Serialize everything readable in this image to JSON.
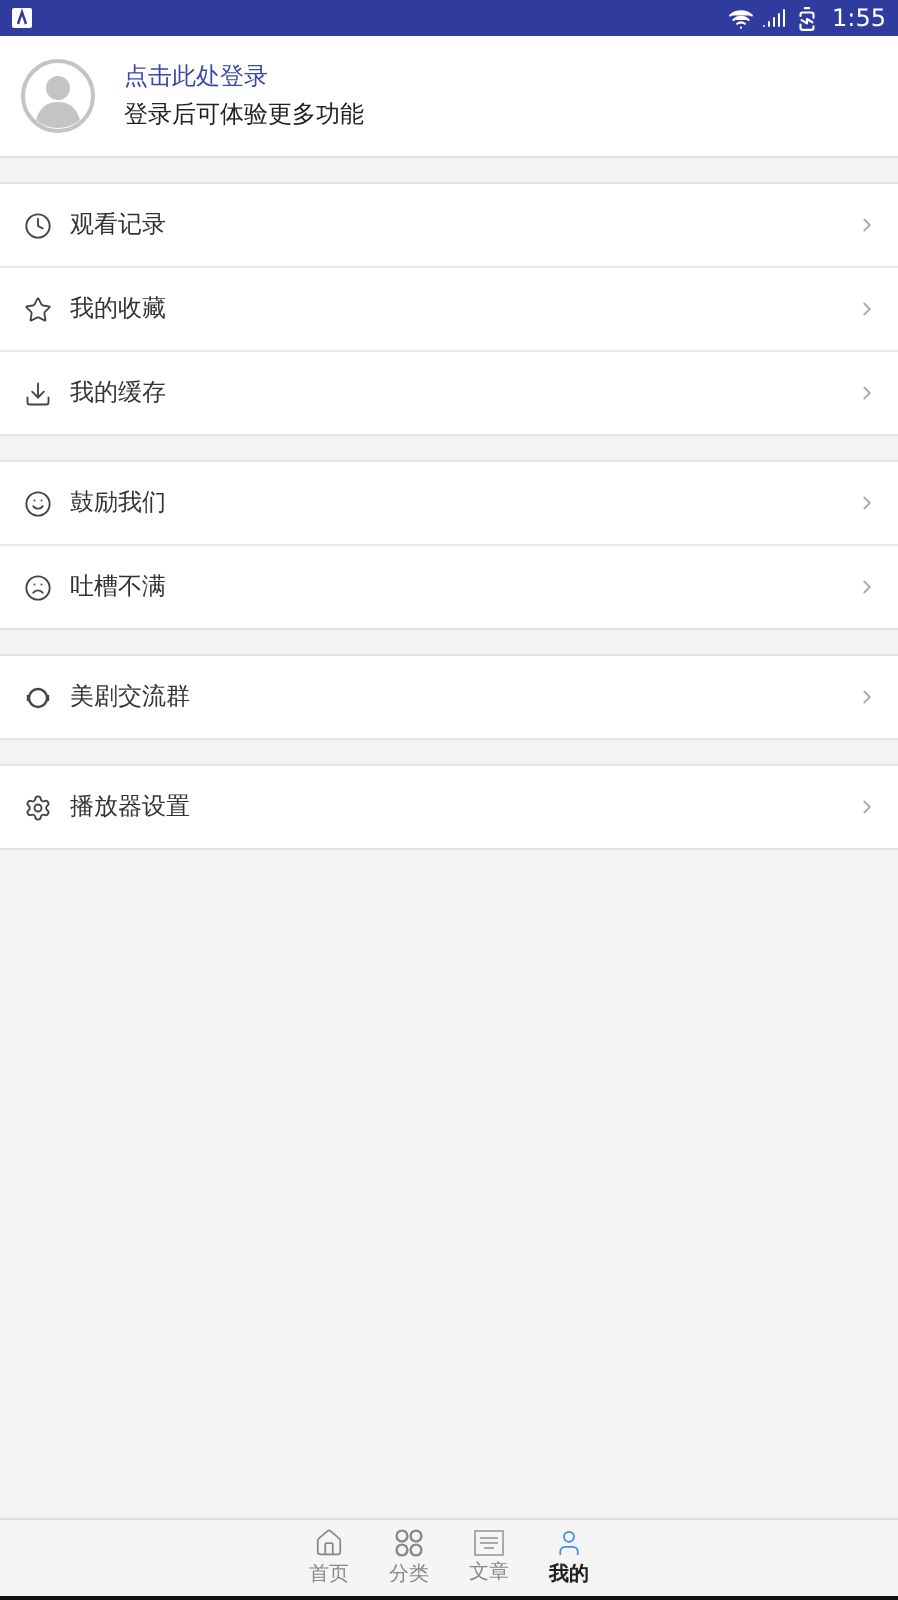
{
  "status_bar": {
    "time": "1:55"
  },
  "profile": {
    "login_link": "点击此处登录",
    "subtitle": "登录后可体验更多功能"
  },
  "menu_groups": [
    {
      "items": [
        {
          "kind": "history",
          "label": "观看记录"
        },
        {
          "kind": "favorites",
          "label": "我的收藏"
        },
        {
          "kind": "downloads",
          "label": "我的缓存"
        }
      ]
    },
    {
      "items": [
        {
          "kind": "praise",
          "label": "鼓励我们"
        },
        {
          "kind": "complain",
          "label": "吐槽不满"
        }
      ]
    },
    {
      "items": [
        {
          "kind": "group",
          "label": "美剧交流群"
        }
      ]
    },
    {
      "items": [
        {
          "kind": "settings",
          "label": "播放器设置"
        }
      ]
    }
  ],
  "bottom_nav": [
    {
      "kind": "home",
      "label": "首页",
      "selected": false
    },
    {
      "kind": "categories",
      "label": "分类",
      "selected": false
    },
    {
      "kind": "articles",
      "label": "文章",
      "selected": false
    },
    {
      "kind": "mine",
      "label": "我的",
      "selected": true
    }
  ]
}
